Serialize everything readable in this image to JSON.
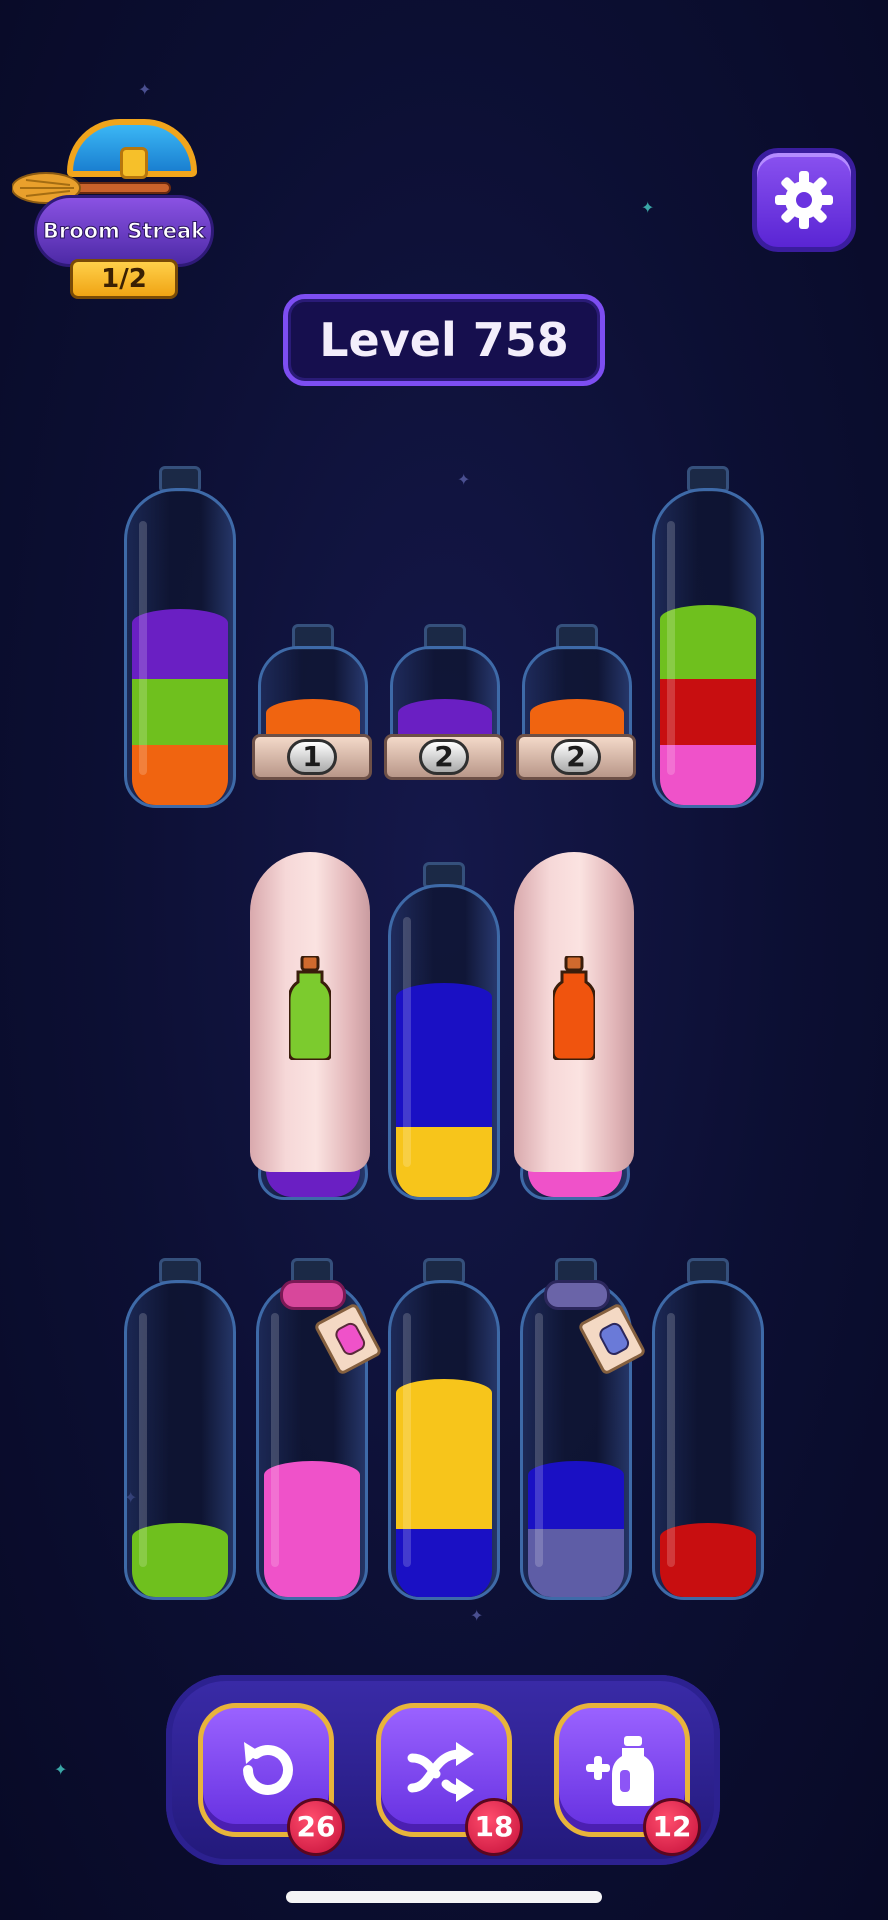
{
  "streak": {
    "label": "Broom Streak",
    "count": "1/2"
  },
  "level": {
    "label": "Level 758"
  },
  "settings": {
    "icon": "gear-icon"
  },
  "colors": {
    "purple": "#6a1fc3",
    "green": "#6fc01e",
    "orange": "#f06410",
    "red": "#c80e10",
    "pink": "#ef52c9",
    "blue": "#1a10c4",
    "yellow": "#f7c51b",
    "slate": "#5e5da6"
  },
  "bottles_row1": [
    {
      "id": "tall-left",
      "layers": [
        "orange",
        "green",
        "purple"
      ]
    },
    {
      "id": "small-1",
      "layers": [
        "orange"
      ],
      "lock_number": "1"
    },
    {
      "id": "small-2",
      "layers": [
        "purple"
      ],
      "lock_number": "2"
    },
    {
      "id": "small-3",
      "layers": [
        "orange"
      ],
      "lock_number": "2"
    },
    {
      "id": "tall-right",
      "layers": [
        "pink",
        "red",
        "green"
      ]
    }
  ],
  "bottles_row2": [
    {
      "id": "covered-left",
      "covered": true,
      "hint_color": "green"
    },
    {
      "id": "middle",
      "layers": [
        "yellow",
        "blue",
        "blue"
      ]
    },
    {
      "id": "covered-right",
      "covered": true,
      "hint_color": "orange"
    }
  ],
  "bottles_row3": [
    {
      "id": "b1",
      "layers": [
        "green"
      ]
    },
    {
      "id": "b2",
      "layers": [
        "pink"
      ],
      "tied": true,
      "rope_color": "pink"
    },
    {
      "id": "b3",
      "layers": [
        "blue",
        "yellow"
      ]
    },
    {
      "id": "b4",
      "layers": [
        "slate",
        "blue"
      ],
      "tied": true,
      "rope_color": "slate"
    },
    {
      "id": "b5",
      "layers": [
        "red"
      ]
    }
  ],
  "tools": {
    "undo": {
      "icon": "undo-icon",
      "count": "26"
    },
    "shuffle": {
      "icon": "shuffle-icon",
      "count": "18"
    },
    "add_bottle": {
      "icon": "add-bottle-icon",
      "count": "12"
    }
  }
}
